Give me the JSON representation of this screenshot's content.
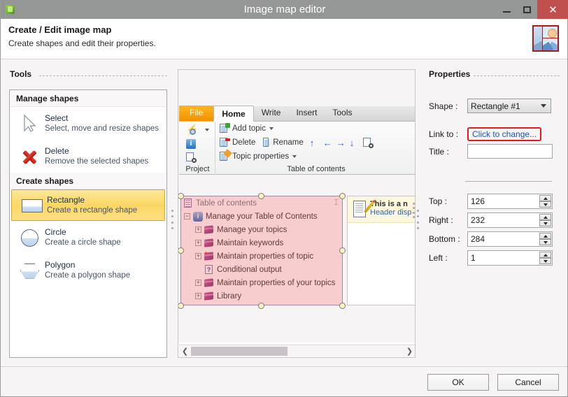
{
  "window": {
    "title": "Image map editor",
    "app_icon": "cube-icon",
    "controls": {
      "minimize": "minimize-icon",
      "maximize": "maximize-icon",
      "close": "✕"
    }
  },
  "header": {
    "title": "Create / Edit image map",
    "subtitle": "Create shapes and edit their properties.",
    "icon": "image-map-icon"
  },
  "tools": {
    "section_title": "Tools",
    "groups": [
      {
        "title": "Manage shapes",
        "items": [
          {
            "name": "Select",
            "desc": "Select, move and resize shapes",
            "icon": "cursor-icon",
            "selected": false
          },
          {
            "name": "Delete",
            "desc": "Remove the selected shapes",
            "icon": "delete-x-icon",
            "selected": false
          }
        ]
      },
      {
        "title": "Create shapes",
        "items": [
          {
            "name": "Rectangle",
            "desc": "Create a rectangle shape",
            "icon": "rectangle-icon",
            "selected": true
          },
          {
            "name": "Circle",
            "desc": "Create a circle shape",
            "icon": "circle-icon",
            "selected": false
          },
          {
            "name": "Polygon",
            "desc": "Create a polygon shape",
            "icon": "polygon-icon",
            "selected": false
          }
        ]
      }
    ]
  },
  "preview": {
    "ribbon": {
      "tabs": [
        {
          "label": "File",
          "style": "file"
        },
        {
          "label": "Home",
          "style": "active"
        },
        {
          "label": "Write",
          "style": "normal"
        },
        {
          "label": "Insert",
          "style": "normal"
        },
        {
          "label": "Tools",
          "style": "normal"
        }
      ],
      "groups": [
        {
          "label": "Project"
        },
        {
          "label": "Table of contents"
        }
      ],
      "commands": {
        "add_topic": "Add topic",
        "delete": "Delete",
        "rename": "Rename",
        "topic_properties": "Topic properties",
        "move_up": "↑",
        "move_left": "←",
        "move_right": "→",
        "move_down": "↓",
        "preview": "preview-icon"
      }
    },
    "tree": {
      "header": "Table of contents",
      "pin": "⌶",
      "nodes": [
        {
          "label": "Manage your Table of Contents",
          "indent": 0,
          "toggle": "−",
          "icon": "info-icon"
        },
        {
          "label": "Manage your topics",
          "indent": 1,
          "toggle": "+",
          "icon": "book-icon"
        },
        {
          "label": "Maintain keywords",
          "indent": 1,
          "toggle": "+",
          "icon": "book-icon"
        },
        {
          "label": "Maintain properties of topic",
          "indent": 1,
          "toggle": "+",
          "icon": "book-sparkle-icon"
        },
        {
          "label": "Conditional output",
          "indent": 1,
          "toggle": "",
          "icon": "question-icon"
        },
        {
          "label": "Maintain properties of your topics",
          "indent": 1,
          "toggle": "+",
          "icon": "book-icon"
        },
        {
          "label": "Library",
          "indent": 1,
          "toggle": "+",
          "icon": "book-icon"
        }
      ]
    },
    "topic_pane": {
      "title": "This is a n",
      "link": "Header disp",
      "icon": "document-pencil-icon"
    },
    "scrollbar": {
      "left_arrow": "❮",
      "right_arrow": "❯"
    }
  },
  "properties": {
    "section_title": "Properties",
    "shape_label": "Shape :",
    "shape_value": "Rectangle #1",
    "link_label": "Link to :",
    "link_value": "Click to change...",
    "link_highlight_color": "#e01b1b",
    "link_text_color": "#1559b5",
    "title_label": "Title :",
    "title_value": "",
    "coords": [
      {
        "label": "Top :",
        "value": "126"
      },
      {
        "label": "Right :",
        "value": "232"
      },
      {
        "label": "Bottom :",
        "value": "284"
      },
      {
        "label": "Left :",
        "value": "1"
      }
    ]
  },
  "footer": {
    "ok": "OK",
    "cancel": "Cancel"
  }
}
